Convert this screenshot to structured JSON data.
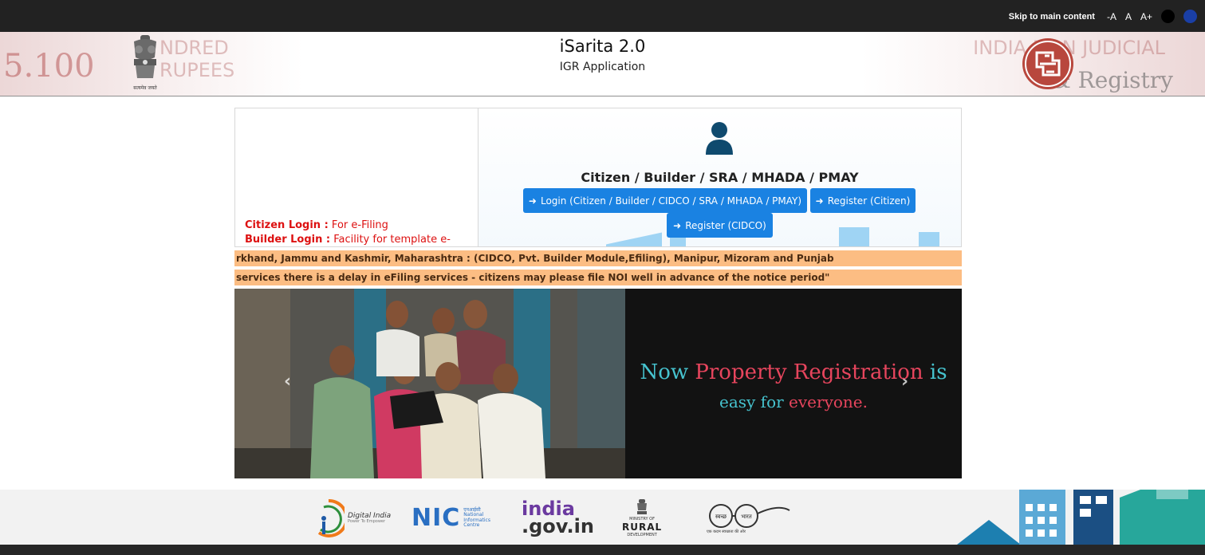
{
  "topbar": {
    "skip_link": "Skip to main content",
    "font_decrease": "-A",
    "font_normal": "A",
    "font_increase": "A+",
    "theme_dark_color": "#000000",
    "theme_blue_color": "#1a3fa6"
  },
  "header": {
    "title": "iSarita 2.0",
    "subtitle": "IGR Application",
    "left_stamp_amount": "5.100",
    "left_stamp_text": "NDRED RUPEES",
    "emblem_caption": "सत्यमेव जयते",
    "right_stamp_text": "INDIA NON JUDICIAL",
    "right_stamp_registry": "& Registry",
    "emblem_icon": "ashoka-emblem-icon",
    "logo_icon": "igr-logo-icon"
  },
  "info": {
    "citizen_label": "Citizen Login :",
    "citizen_text": " For e-Filing",
    "builder_label": "Builder Login :",
    "builder_text": " Facility for template e-"
  },
  "login": {
    "role_title": "Citizen / Builder / SRA / MHADA / PMAY",
    "user_icon": "user-icon",
    "login_button": "Login (Citizen / Builder / CIDCO / SRA / MHADA / PMAY)",
    "register_citizen_button": "Register (Citizen)",
    "register_cidco_button": "Register (CIDCO)",
    "button_color": "#1a82e2"
  },
  "tickers": {
    "line1": "rkhand, Jammu and Kashmir, Maharashtra : (CIDCO, Pvt. Builder Module,Efiling), Manipur, Mizoram and Punjab",
    "line2": "services there is a delay in eFiling services - citizens may please file NOI well in advance of the notice period\"",
    "background": "#fcbd83"
  },
  "banner": {
    "slogan_a": "Now ",
    "slogan_b": "Property Registration",
    "slogan_c": " is",
    "slogan_d": "easy for ",
    "slogan_e": "everyone.",
    "prev_icon": "‹",
    "next_icon": "›",
    "teal_color": "#46c3cf",
    "pink_color": "#e7455d"
  },
  "partners": {
    "digital_india": "Digital India",
    "digital_india_tag": "Power To Empower",
    "nic": "NIC",
    "nic_hindi": "एनआईसी",
    "nic_full_1": "National",
    "nic_full_2": "Informatics",
    "nic_full_3": "Centre",
    "india_gov_1": "india",
    "india_gov_2": ".gov.in",
    "rural_1": "MINISTRY OF",
    "rural_2": "RURAL",
    "rural_3": "DEVELOPMENT",
    "swachh_1": "स्वच्छ",
    "swachh_2": "भारत",
    "swachh_tag": "एक कदम स्वच्छता की ओर"
  }
}
